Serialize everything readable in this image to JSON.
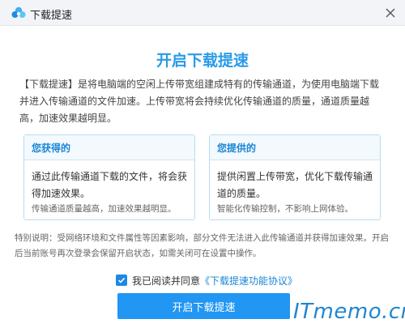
{
  "window": {
    "title": "下载提速",
    "app_icon": "cloud-icon",
    "close_icon": "close-icon",
    "accent_color": "#2a9be8"
  },
  "main": {
    "heading": "开启下载提速",
    "description": "【下载提速】是将电脑端的空闲上传带宽组建成特有的传输通道，为使用电脑端下载并进入传输通道的文件加速。上传带宽将会持续优化传输通道的质量，通道质量越高，加速效果越明显。"
  },
  "cards": {
    "gain": {
      "title": "您获得的",
      "body": "通过此传输通道下载的文件，将会获得加速效果。",
      "footnote": "传输通道质量越高，加速效果越明显。"
    },
    "provide": {
      "title": "您提供的",
      "body": "提供闲置上传带宽，优化下载传输通道的质量。",
      "footnote": "智能化传输控制，不影响上网体验。"
    }
  },
  "note": {
    "text": "特别说明：受网络环境和文件属性等因素影响，部分文件无法进入此传输通道并获得加速效果。开启后当前账号再次登录会保留开启状态，如需关闭可在设置中操作。"
  },
  "agreement": {
    "checked": true,
    "label": "我已阅读并同意",
    "link": "《下载提速功能协议》"
  },
  "actions": {
    "enable_label": "开启下载提速"
  },
  "watermark": {
    "text": "ITmemo.cn"
  }
}
